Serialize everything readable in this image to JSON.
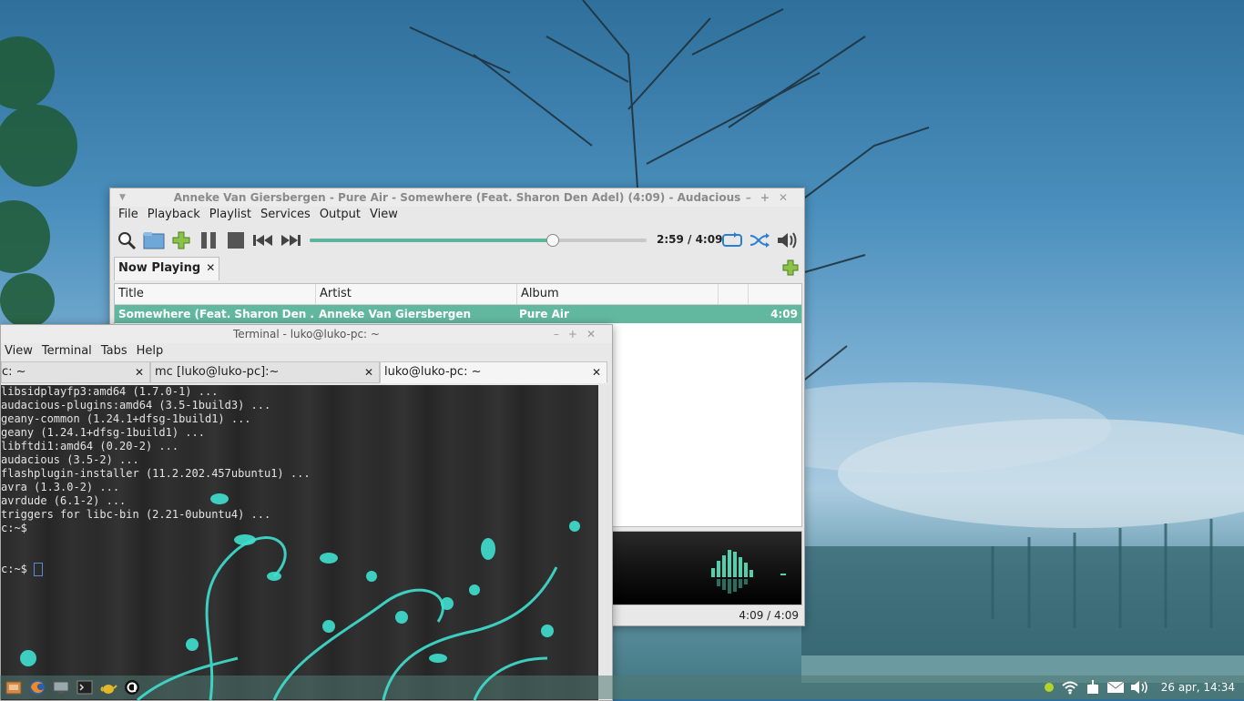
{
  "audacious": {
    "title": "Anneke Van Giersbergen - Pure Air - Somewhere (Feat. Sharon Den Adel) (4:09) - Audacious",
    "menu": [
      "File",
      "Playback",
      "Playlist",
      "Services",
      "Output",
      "View"
    ],
    "time": "2:59 / 4:09",
    "progress": 0.72,
    "playlist_tab": "Now Playing",
    "columns": [
      "Title",
      "Artist",
      "Album"
    ],
    "rows": [
      {
        "title": "Somewhere (Feat. Sharon Den ...",
        "artist": "Anneke Van Giersbergen",
        "album": "Pure Air",
        "length": "4:09"
      }
    ],
    "status_time": "4:09 / 4:09",
    "accent": "#62b89e"
  },
  "terminal": {
    "title": "Terminal - luko@luko-pc: ~",
    "menu": [
      "View",
      "Terminal",
      "Tabs",
      "Help"
    ],
    "tabs": [
      {
        "label": "c: ~"
      },
      {
        "label": "mc [luko@luko-pc]:~"
      },
      {
        "label": "luko@luko-pc: ~"
      }
    ],
    "lines": [
      "libsidplayfp3:amd64 (1.7.0-1) ...",
      "audacious-plugins:amd64 (3.5-1build3) ...",
      "geany-common (1.24.1+dfsg-1build1) ...",
      "geany (1.24.1+dfsg-1build1) ...",
      "libftdi1:amd64 (0.20-2) ...",
      "audacious (3.5-2) ...",
      "flashplugin-installer (11.2.202.457ubuntu1) ...",
      "avra (1.3.0-2) ...",
      "avrdude (6.1-2) ...",
      "triggers for libc-bin (2.21-0ubuntu4) ...",
      "c:~$",
      "",
      "",
      "c:~$ "
    ]
  },
  "taskbar": {
    "clock": "26 apr, 14:34"
  }
}
